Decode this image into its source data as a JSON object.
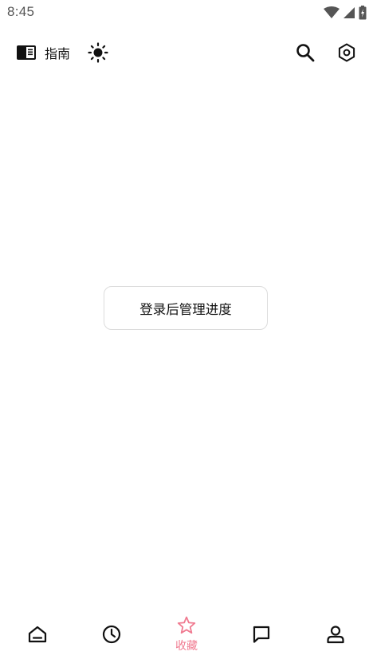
{
  "status_bar": {
    "time": "8:45"
  },
  "app_bar": {
    "guide_label": "指南"
  },
  "main": {
    "login_prompt": "登录后管理进度"
  },
  "bottom_nav": {
    "favorites_label": "收藏",
    "active_color": "#f07a90"
  },
  "icons": {
    "guide": "book-icon",
    "theme": "sun-icon",
    "search": "search-icon",
    "settings": "settings-hexagon-icon",
    "home": "home-icon",
    "history": "clock-icon",
    "favorites": "star-icon",
    "messages": "chat-icon",
    "profile": "person-icon"
  }
}
